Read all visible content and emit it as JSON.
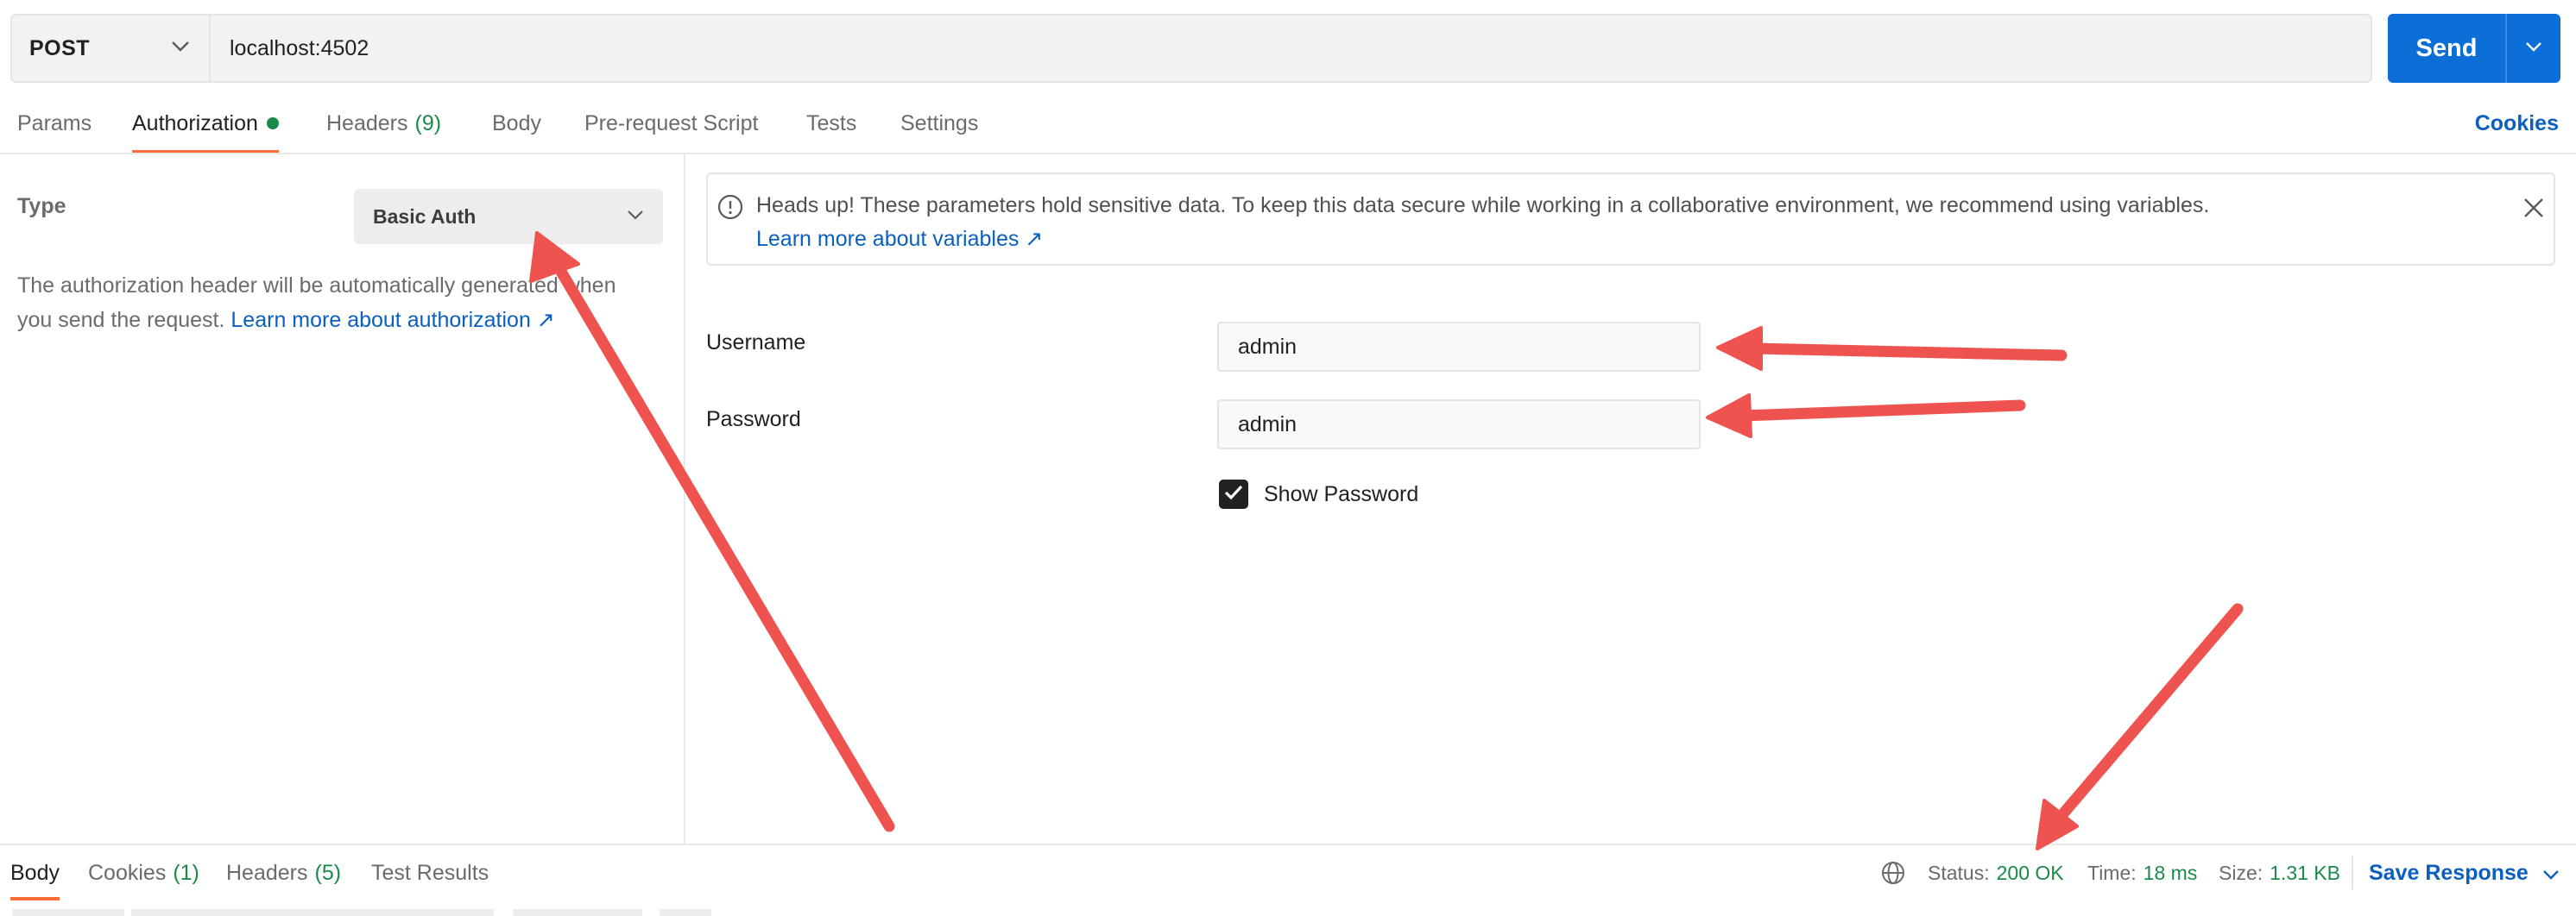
{
  "request": {
    "method": "POST",
    "url": "localhost:4502",
    "send_label": "Send"
  },
  "request_tabs": {
    "params": "Params",
    "authorization": "Authorization",
    "headers": "Headers",
    "headers_count": "(9)",
    "body": "Body",
    "pre_request_script": "Pre-request Script",
    "tests": "Tests",
    "settings": "Settings",
    "cookies": "Cookies"
  },
  "auth": {
    "type_label": "Type",
    "type_value": "Basic Auth",
    "description": "The authorization header will be automatically generated when you send the request.",
    "learn_more": "Learn more about authorization ↗"
  },
  "alert": {
    "text": "Heads up! These parameters hold sensitive data. To keep this data secure while working in a collaborative environment, we recommend using variables.",
    "link": "Learn more about variables ↗"
  },
  "fields": {
    "username_label": "Username",
    "username_value": "admin",
    "password_label": "Password",
    "password_value": "admin",
    "show_password_label": "Show Password",
    "show_password_checked": true
  },
  "response": {
    "tabs": {
      "body": "Body",
      "cookies": "Cookies",
      "cookies_count": "(1)",
      "headers": "Headers",
      "headers_count": "(5)",
      "test_results": "Test Results"
    },
    "status_label": "Status:",
    "status_value": "200 OK",
    "time_label": "Time:",
    "time_value": "18 ms",
    "size_label": "Size:",
    "size_value": "1.31 KB",
    "save_label": "Save Response"
  },
  "colors": {
    "accent_tab": "#ff6c37",
    "send_button": "#0c6fd8",
    "link": "#0a5fbf",
    "success": "#1a8a4a",
    "annotation_arrow": "#ef5350"
  },
  "icons": [
    "chevron-down-icon",
    "info-icon",
    "close-icon",
    "check-icon",
    "globe-icon"
  ]
}
